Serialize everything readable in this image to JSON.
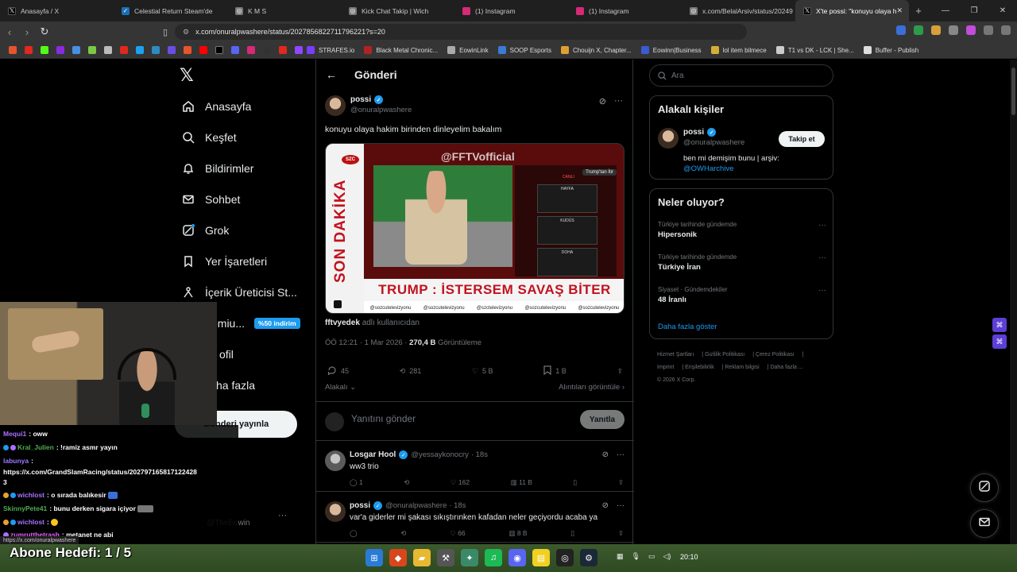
{
  "browser": {
    "tabs": [
      {
        "label": "Anasayfa / X",
        "icon": "x-icon",
        "color": "#000000"
      },
      {
        "label": "Celestial Return Steam'de",
        "icon": "steam-icon",
        "color": "#1b6fb8"
      },
      {
        "label": "K M S",
        "icon": "globe-icon",
        "color": "#777777"
      },
      {
        "label": "Kick Chat Takip | Wich",
        "icon": "globe-icon",
        "color": "#777777"
      },
      {
        "label": "(1) Instagram",
        "icon": "instagram-icon",
        "color": "#d62976"
      },
      {
        "label": "(1) Instagram",
        "icon": "instagram-icon",
        "color": "#d62976"
      },
      {
        "label": "x.com/BelalArsiv/status/20249",
        "icon": "globe-icon",
        "color": "#777777"
      },
      {
        "label": "X'te possi: \"konuyu olaya h",
        "icon": "x-icon",
        "color": "#000000"
      }
    ],
    "new_tab": "+",
    "url": "x.com/onuralpwashere/status/2027856822711796221?s=20",
    "bookmarks": [
      {
        "label": "STRAFES.io",
        "color": "#7a3cff"
      },
      {
        "label": "Black Metal Chronic...",
        "color": "#b22222"
      },
      {
        "label": "EowinLink",
        "color": "#aaaaaa"
      },
      {
        "label": "SOOP Esports",
        "color": "#3a7bd5"
      },
      {
        "label": "Chouijn X, Chapter...",
        "color": "#e0a030"
      },
      {
        "label": "Eowinn|Business",
        "color": "#3a5bd5"
      },
      {
        "label": "lol item bilmece",
        "color": "#d4af37"
      },
      {
        "label": "T1 vs DK - LCK | She...",
        "color": "#cccccc"
      },
      {
        "label": "Buffer - Publish",
        "color": "#dddddd"
      }
    ]
  },
  "nav": {
    "items": [
      {
        "label": "Anasayfa",
        "icon": "home-icon"
      },
      {
        "label": "Keşfet",
        "icon": "search-icon"
      },
      {
        "label": "Bildirimler",
        "icon": "bell-icon"
      },
      {
        "label": "Sohbet",
        "icon": "mail-icon"
      },
      {
        "label": "Grok",
        "icon": "grok-icon"
      },
      {
        "label": "Yer İşaretleri",
        "icon": "bookmark-icon"
      },
      {
        "label": "İçerik Üreticisi St...",
        "icon": "creator-icon"
      },
      {
        "label": "emiu...",
        "icon": "premium-icon"
      },
      {
        "label": "ofil",
        "icon": "profile-icon"
      },
      {
        "label": "ha fazla",
        "icon": "more-icon"
      }
    ],
    "premium_badge": "%50 indirim",
    "post_button": "Gönderi yayınla",
    "profile_handle": "@TheEowin",
    "profile_more": "···"
  },
  "main": {
    "title": "Gönderi",
    "tweet": {
      "name": "possi",
      "handle": "@onuralpwashere",
      "text": "konuyu olaya hakim birinden dinleyelim bakalım",
      "media": {
        "watermark": "@FFTVofficial",
        "side_text": "SON DAKİKA",
        "logo": "SZC",
        "live_tag": "Trump'tan İtir",
        "mini_labels": [
          "CANLI",
          "HAYFA",
          "KUDÜS",
          "DOHA"
        ],
        "banner": "TRUMP : İSTERSEM SAVAŞ BİTER",
        "socials": [
          "@sozcutelevizyonu",
          "@sozcutelevizyonu",
          "@szctelevizyonu",
          "@sozcutelevizyonu",
          "@sozcutelevizyonu"
        ]
      },
      "from_user": "fftvyedek",
      "from_suffix": "adlı kullanıcıdan",
      "time": "ÖÖ 12:21 · 1 Mar 2026 · ",
      "views_count": "270,4 B",
      "views_label": "Görüntüleme",
      "replies": "45",
      "reposts": "281",
      "likes": "5 B",
      "bookmarks": "1 B",
      "sort_label": "Alakalı",
      "quotes_link": "Alıntıları görüntüle"
    },
    "reply_box": {
      "placeholder": "Yanıtını gönder",
      "button": "Yanıtla"
    },
    "replies": [
      {
        "name": "Losgar Hool",
        "handle": "@yessaykonocry",
        "time": "· 18s",
        "text": "ww3 trio",
        "replies": "1",
        "reposts": "",
        "likes": "162",
        "views": "11 B"
      },
      {
        "name": "possi",
        "handle": "@onuralpwashere",
        "time": "· 18s",
        "text": "var'a giderler mi şakası sıkıştırınken kafadan neler geçiyordu acaba ya",
        "replies": "",
        "reposts": "",
        "likes": "66",
        "views": "8 B"
      }
    ]
  },
  "right": {
    "search_placeholder": "Ara",
    "relevant": {
      "title": "Alakalı kişiler",
      "name": "possi",
      "handle": "@onuralpwashere",
      "follow": "Takip et",
      "bio": "ben mi demişim bunu | arşiv:",
      "bio_link": "@OWHarchive"
    },
    "trends": {
      "title": "Neler oluyor?",
      "items": [
        {
          "context": "Türkiye tarihinde gündemde",
          "name": "Hipersonik"
        },
        {
          "context": "Türkiye tarihinde gündemde",
          "name": "Türkiye İran"
        },
        {
          "context": "Siyaset · Gündemdekiler",
          "name": "48 İranlı"
        }
      ],
      "show_more": "Daha fazla göster"
    },
    "footer": [
      "Hizmet Şartları",
      "Gizlilik Politikası",
      "Çerez Politikası",
      "Imprint",
      "Erişilebilirlik",
      "Reklam bilgisi",
      "Daha fazla ...",
      "© 2026 X Corp."
    ]
  },
  "stream": {
    "chat": [
      {
        "user": "Mequi1",
        "color": "#a970ff",
        "msg": ": oww"
      },
      {
        "user": "Kral_Julien",
        "color": "#4caf50",
        "msg": ": !ramiz asmr yayın"
      },
      {
        "user": "labunya",
        "color": "#9b7bff",
        "msg": ":"
      },
      {
        "user": "",
        "color": "#ffffff",
        "msg": "https://x.com/GrandSlamRacing/status/202797165817122428"
      },
      {
        "user": "",
        "color": "#ffffff",
        "msg": "3"
      },
      {
        "user": "wichlost",
        "color": "#a970ff",
        "msg": ": o sırada balıkesir"
      },
      {
        "user": "SkinnyPete41",
        "color": "#4caf50",
        "msg": ": bunu derken sigara içiyor"
      },
      {
        "user": "wichlost",
        "color": "#a970ff",
        "msg": ":"
      },
      {
        "user": "zumrutthetrash",
        "color": "#e85dff",
        "msg": ": metanet ne abi"
      }
    ],
    "hover_url": "https://x.com/onuralpwashere",
    "sub_goal": "Abone Hedefi:   1 / 5"
  },
  "taskbar": {
    "clock": "20:10"
  }
}
